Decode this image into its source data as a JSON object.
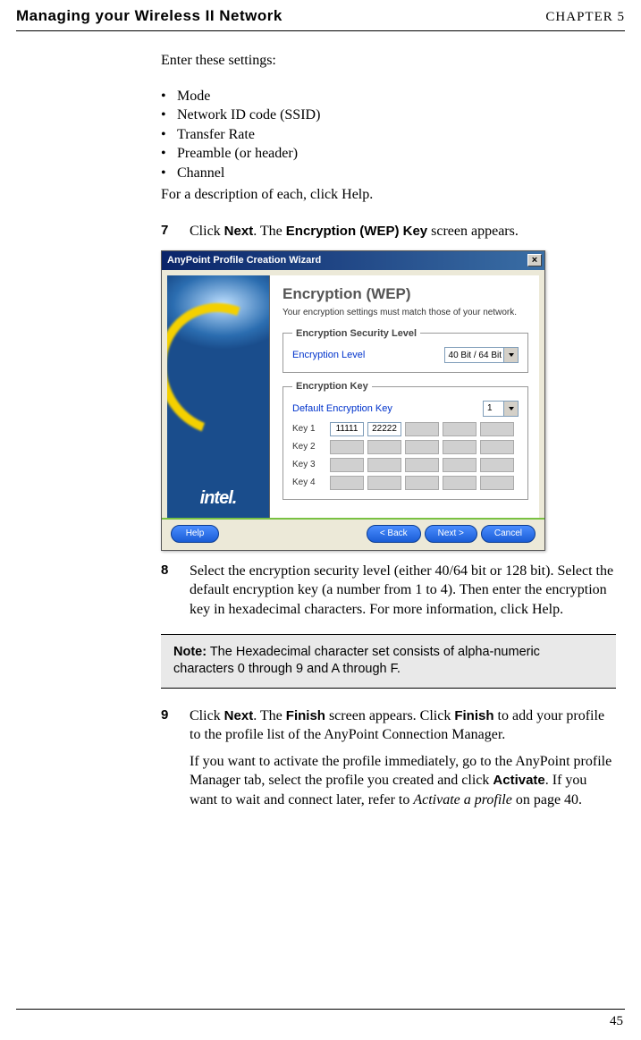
{
  "header": {
    "title": "Managing your Wireless II Network",
    "chapter": "CHAPTER 5"
  },
  "intro": "Enter these settings:",
  "bullets": [
    "Mode",
    "Network ID code (SSID)",
    "Transfer Rate",
    "Preamble (or header)",
    "Channel"
  ],
  "bullet_footer": "For a description of each, click Help.",
  "step7": {
    "num": "7",
    "t1": "Click ",
    "b1": "Next",
    "t2": ". The ",
    "b2": "Encryption (WEP) Key",
    "t3": " screen appears."
  },
  "wizard": {
    "titlebar": "AnyPoint Profile Creation Wizard",
    "heading": "Encryption (WEP)",
    "sub": "Your encryption settings must match those of your network.",
    "sec_legend": "Encryption Security Level",
    "enc_label": "Encryption Level",
    "enc_value": "40 Bit / 64 Bit",
    "key_legend": "Encryption Key",
    "def_label": "Default Encryption Key",
    "def_value": "1",
    "rows": {
      "k1": "Key 1",
      "k2": "Key 2",
      "k3": "Key 3",
      "k4": "Key 4"
    },
    "cells": {
      "c1": "11111",
      "c2": "22222"
    },
    "logo": "intel.",
    "buttons": {
      "help": "Help",
      "back": "< Back",
      "next": "Next >",
      "cancel": "Cancel"
    }
  },
  "step8": {
    "num": "8",
    "text": "Select the encryption security level (either 40/64 bit or 128 bit). Select the default encryption key (a number from 1 to 4). Then enter the encryption key in hexadecimal characters. For more information, click Help."
  },
  "note": {
    "label": "Note:",
    "text": "  The Hexadecimal character set consists of alpha-numeric characters 0 through 9 and A through F."
  },
  "step9": {
    "num": "9",
    "p1a": "Click ",
    "p1b": "Next",
    "p1c": ". The ",
    "p1d": "Finish",
    "p1e": " screen appears. Click ",
    "p1f": "Finish",
    "p1g": " to add your profile to the profile list of the AnyPoint Connection Manager.",
    "p2a": "If you want to activate the profile immediately, go to the AnyPoint profile Manager tab, select the profile you created and click ",
    "p2b": "Activate",
    "p2c": ". If you want to wait and connect later, refer to ",
    "p2d": "Activate a profile",
    "p2e": " on page 40."
  },
  "page_num": "45"
}
